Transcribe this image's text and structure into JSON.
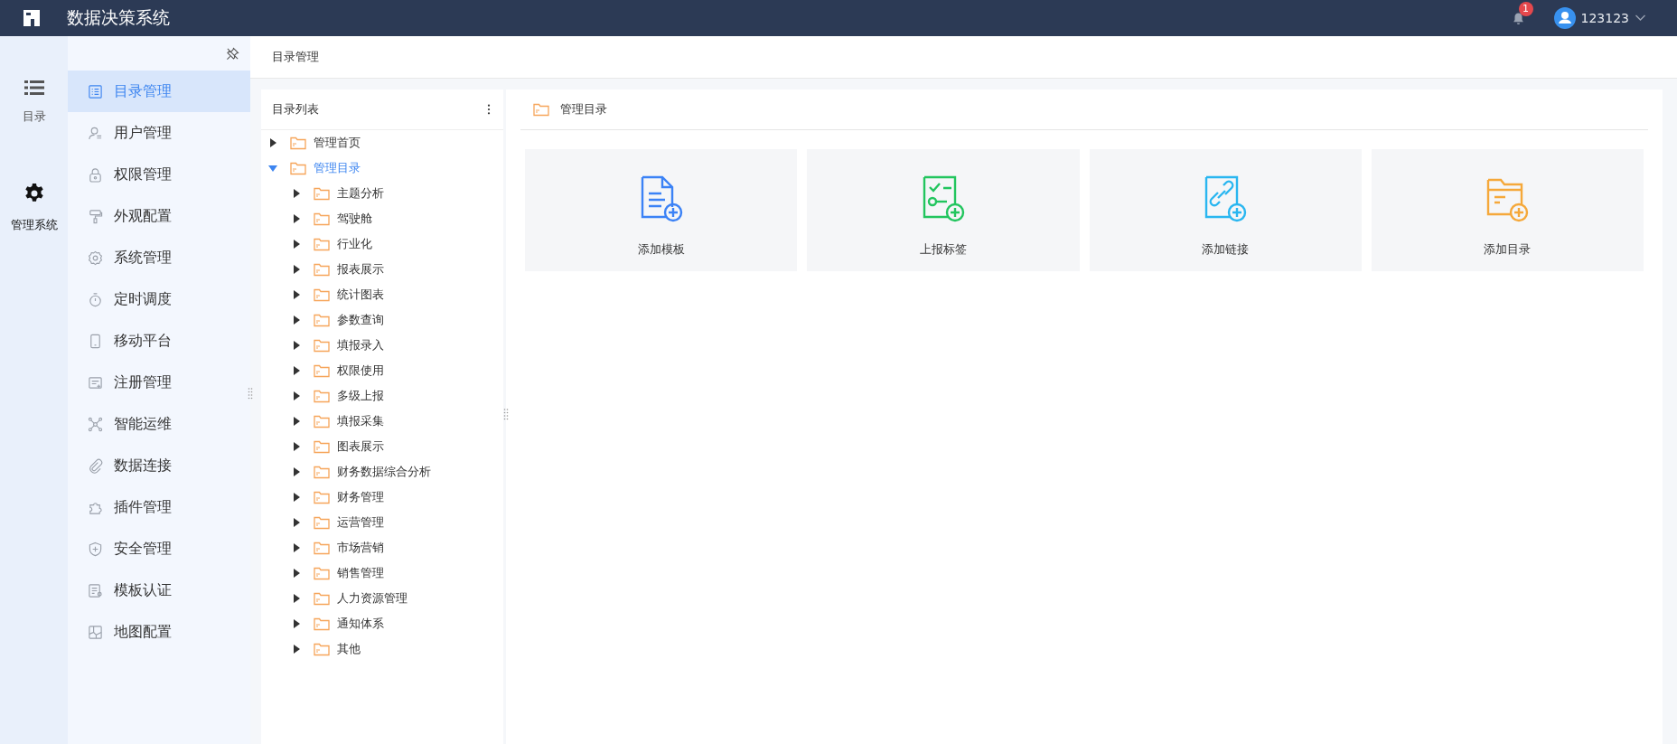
{
  "header": {
    "title": "数据决策系统",
    "notifications": {
      "count": "1"
    },
    "user": {
      "name": "123123"
    }
  },
  "rail": [
    {
      "label": "目录",
      "selected": false
    },
    {
      "label": "管理系统",
      "selected": true
    }
  ],
  "sidebar": {
    "items": [
      {
        "label": "目录管理",
        "selected": true
      },
      {
        "label": "用户管理",
        "selected": false
      },
      {
        "label": "权限管理",
        "selected": false
      },
      {
        "label": "外观配置",
        "selected": false
      },
      {
        "label": "系统管理",
        "selected": false
      },
      {
        "label": "定时调度",
        "selected": false
      },
      {
        "label": "移动平台",
        "selected": false
      },
      {
        "label": "注册管理",
        "selected": false
      },
      {
        "label": "智能运维",
        "selected": false
      },
      {
        "label": "数据连接",
        "selected": false
      },
      {
        "label": "插件管理",
        "selected": false
      },
      {
        "label": "安全管理",
        "selected": false
      },
      {
        "label": "模板认证",
        "selected": false
      },
      {
        "label": "地图配置",
        "selected": false
      }
    ]
  },
  "breadcrumb": "目录管理",
  "tree_panel": {
    "title": "目录列表",
    "items": [
      {
        "label": "管理首页",
        "expanded": false,
        "selected": false
      },
      {
        "label": "管理目录",
        "expanded": true,
        "selected": true,
        "children": [
          {
            "label": "主题分析",
            "expanded": false,
            "selected": false
          },
          {
            "label": "驾驶舱",
            "expanded": false,
            "selected": false
          },
          {
            "label": "行业化",
            "expanded": false,
            "selected": false
          },
          {
            "label": "报表展示",
            "expanded": false,
            "selected": false
          },
          {
            "label": "统计图表",
            "expanded": false,
            "selected": false
          },
          {
            "label": "参数查询",
            "expanded": false,
            "selected": false
          },
          {
            "label": "填报录入",
            "expanded": false,
            "selected": false
          },
          {
            "label": "权限使用",
            "expanded": false,
            "selected": false
          },
          {
            "label": "多级上报",
            "expanded": false,
            "selected": false
          },
          {
            "label": "填报采集",
            "expanded": false,
            "selected": false
          },
          {
            "label": "图表展示",
            "expanded": false,
            "selected": false
          },
          {
            "label": "财务数据综合分析",
            "expanded": false,
            "selected": false
          },
          {
            "label": "财务管理",
            "expanded": false,
            "selected": false
          },
          {
            "label": "运营管理",
            "expanded": false,
            "selected": false
          },
          {
            "label": "市场营销",
            "expanded": false,
            "selected": false
          },
          {
            "label": "销售管理",
            "expanded": false,
            "selected": false
          },
          {
            "label": "人力资源管理",
            "expanded": false,
            "selected": false
          },
          {
            "label": "通知体系",
            "expanded": false,
            "selected": false
          },
          {
            "label": "其他",
            "expanded": false,
            "selected": false
          }
        ]
      }
    ]
  },
  "content": {
    "title": "管理目录",
    "actions": [
      {
        "kind": "template",
        "label": "添加模板",
        "color": "#3b82f6"
      },
      {
        "kind": "tag",
        "label": "上报标签",
        "color": "#22c55e"
      },
      {
        "kind": "link",
        "label": "添加链接",
        "color": "#29b6f0"
      },
      {
        "kind": "folder",
        "label": "添加目录",
        "color": "#f5a83a"
      }
    ]
  }
}
